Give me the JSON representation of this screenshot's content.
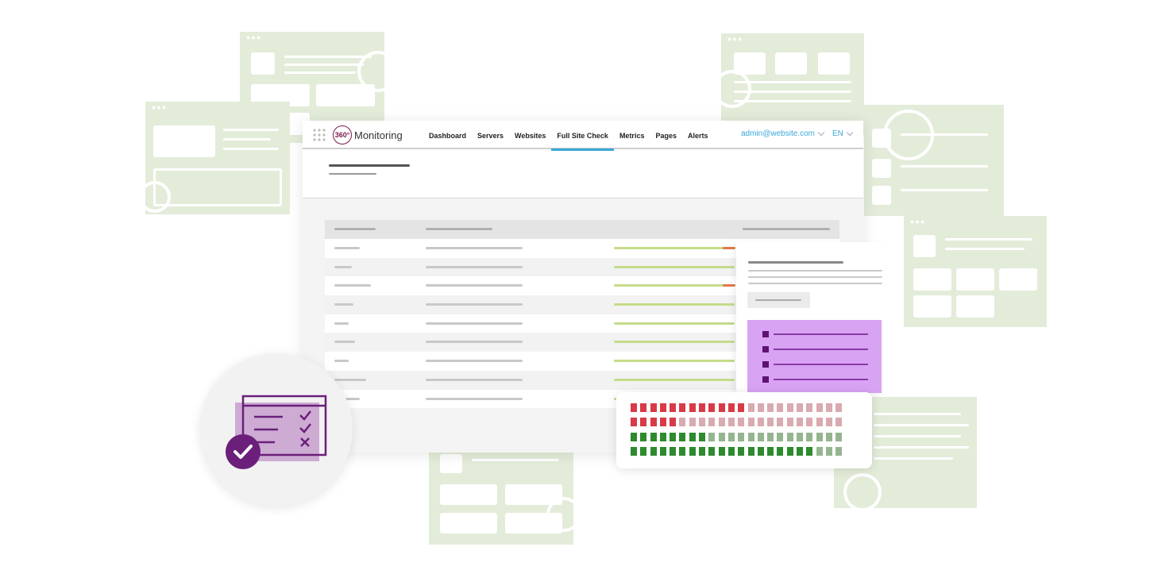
{
  "brand": {
    "logo_mark": "360°",
    "name": "Monitoring",
    "mark_color": "#7a1a4b"
  },
  "nav": {
    "items": [
      {
        "label": "Dashboard",
        "active": false
      },
      {
        "label": "Servers",
        "active": false
      },
      {
        "label": "Websites",
        "active": false
      },
      {
        "label": "Full Site Check",
        "active": true
      },
      {
        "label": "Metrics",
        "active": false
      },
      {
        "label": "Pages",
        "active": false
      },
      {
        "label": "Alerts",
        "active": false
      }
    ],
    "user": "admin@website.com",
    "language": "EN",
    "accent_color": "#3aa7d8"
  },
  "icons": {
    "apps_menu": "grid-dots-icon",
    "user_menu": "chevron-down-icon",
    "lang_menu": "chevron-down-icon",
    "badge": "checklist-check-icon"
  },
  "status_grid": {
    "rows": [
      "RRRRRRRRRRRRrrrrrrrrrr",
      "RRRRRrrrrrrrrrrrrrrrrr",
      "GGGGGGGGgggggggggggggg",
      "GGGGGGGGGGGGGGGGGGGggg"
    ],
    "colors": {
      "R": "#d83a48",
      "r": "#d9aab0",
      "G": "#2e8a2e",
      "g": "#95b590"
    }
  },
  "table": {
    "rows": 9,
    "row_status_colors": {
      "ok": "#c5dc8a",
      "warn": "#e07a4a"
    }
  }
}
